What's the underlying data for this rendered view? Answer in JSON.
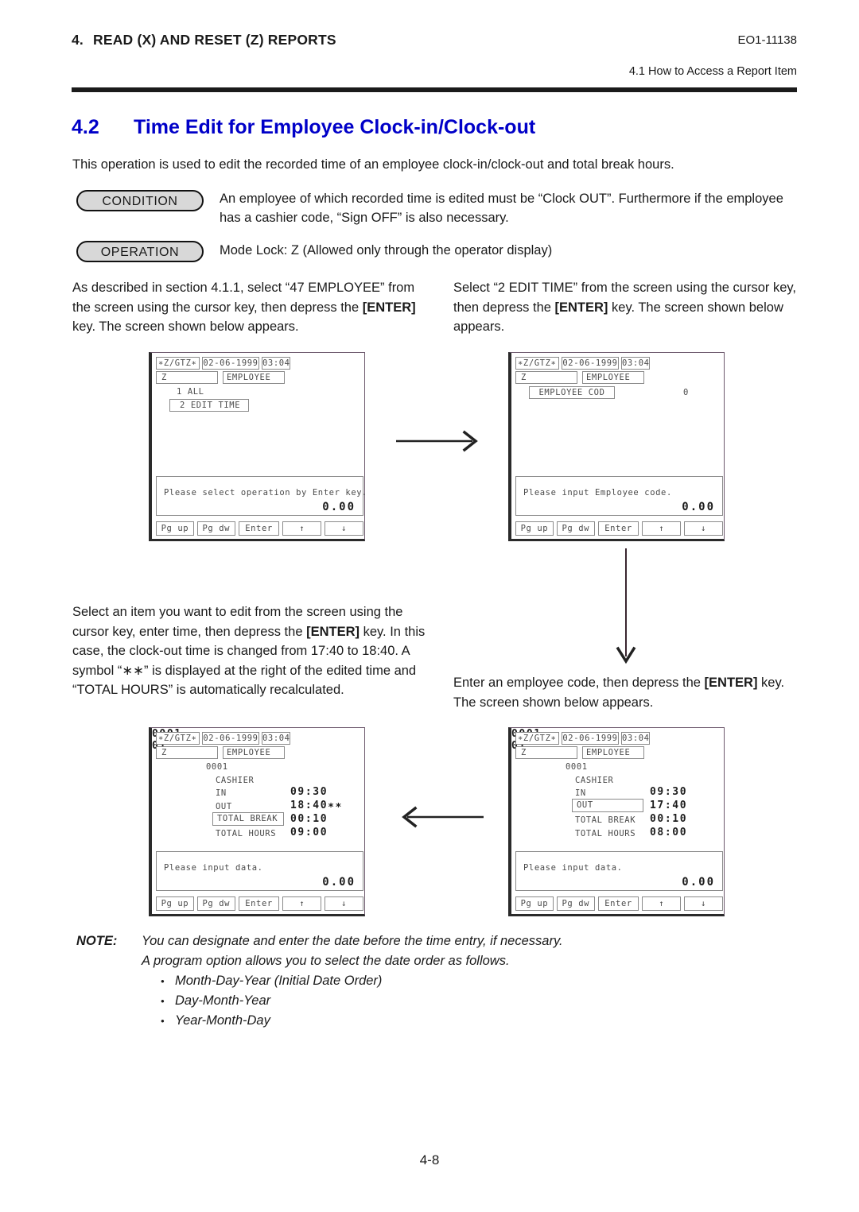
{
  "header": {
    "chapter_number": "4.",
    "chapter_title": "READ (X) AND RESET (Z) REPORTS",
    "doc_code": "EO1-11138",
    "sub_reference": "4.1  How to Access a Report Item"
  },
  "section": {
    "number": "4.2",
    "title": "Time Edit for Employee Clock-in/Clock-out",
    "intro": "This operation is used to edit the recorded time of an employee clock-in/clock-out and total break hours."
  },
  "blocks": {
    "condition_label": "CONDITION",
    "condition_text": "An employee of which recorded time is edited must be “Clock OUT”. Furthermore if the employee has a cashier code, “Sign OFF” is also necessary.",
    "operation_label": "OPERATION",
    "operation_text": "Mode Lock:  Z (Allowed only through the operator display)"
  },
  "instructions": {
    "step1_left_a": "As described in section 4.1.1, select “47 EMPLOYEE” from the screen using the cursor key, then depress the ",
    "step1_left_key": "[ENTER]",
    "step1_left_b": " key. The screen shown below appears.",
    "step1_right_a": "Select “2 EDIT TIME” from the screen using the cursor key, then depress the ",
    "step1_right_key": "[ENTER]",
    "step1_right_b": " key. The screen shown below appears.",
    "step2_left_a": "Select an item you want to edit from the screen using the cursor key, enter time, then depress the ",
    "step2_left_key": "[ENTER]",
    "step2_left_b": " key. In this case, the clock-out time is changed from 17:40 to 18:40. A symbol “∗∗” is displayed at the right of the edited time and “TOTAL HOURS” is automatically recalculated.",
    "step2_right_a": "Enter an employee code, then depress the ",
    "step2_right_key": "[ENTER]",
    "step2_right_b": " key. The screen shown below appears."
  },
  "screens": {
    "common": {
      "mode": "∗Z/GTZ∗",
      "date": "02-06-1999",
      "time": "03:04",
      "z_field": "Z",
      "employee_field": "EMPLOYEE",
      "amount": "0.00",
      "keys": [
        "Pg up",
        "Pg dw",
        "Enter",
        "↑",
        "↓"
      ]
    },
    "screen1": {
      "menu_item_1": "1 ALL",
      "menu_item_2": "2 EDIT TIME",
      "message": "Please select operation by Enter key."
    },
    "screen2": {
      "code_label": "EMPLOYEE COD",
      "code_value": "0",
      "message": "Please input Employee code."
    },
    "screen3": {
      "emp_no": "0001",
      "emp_code": "0001",
      "cashier_no": "01",
      "cashier_label": "CASHIER",
      "row_in_label": "IN",
      "row_in_value": "09:30",
      "row_out_label": "OUT",
      "row_out_value": "18:40∗∗",
      "row_break_label": "TOTAL BREAK",
      "row_break_value": "00:10",
      "row_hours_label": "TOTAL HOURS",
      "row_hours_value": "09:00",
      "message": "Please input data."
    },
    "screen4": {
      "emp_no": "0001",
      "emp_code": "0001",
      "cashier_no": "01",
      "cashier_label": "CASHIER",
      "row_in_label": "IN",
      "row_in_value": "09:30",
      "row_out_label": "OUT",
      "row_out_value": "17:40",
      "row_break_label": "TOTAL BREAK",
      "row_break_value": "00:10",
      "row_hours_label": "TOTAL HOURS",
      "row_hours_value": "08:00",
      "message": "Please input data."
    }
  },
  "note": {
    "label": "NOTE:",
    "line1": "You can designate and enter the date before the time entry, if necessary.",
    "line2": "A program option allows you to select the date order as follows.",
    "items": [
      "Month-Day-Year (Initial Date Order)",
      "Day-Month-Year",
      "Year-Month-Day"
    ]
  },
  "footer": {
    "page_number": "4-8"
  },
  "colors": {
    "heading_blue": "#0000c8",
    "rule_black": "#1b1b1b",
    "pill_fill": "#d8d8d8"
  }
}
